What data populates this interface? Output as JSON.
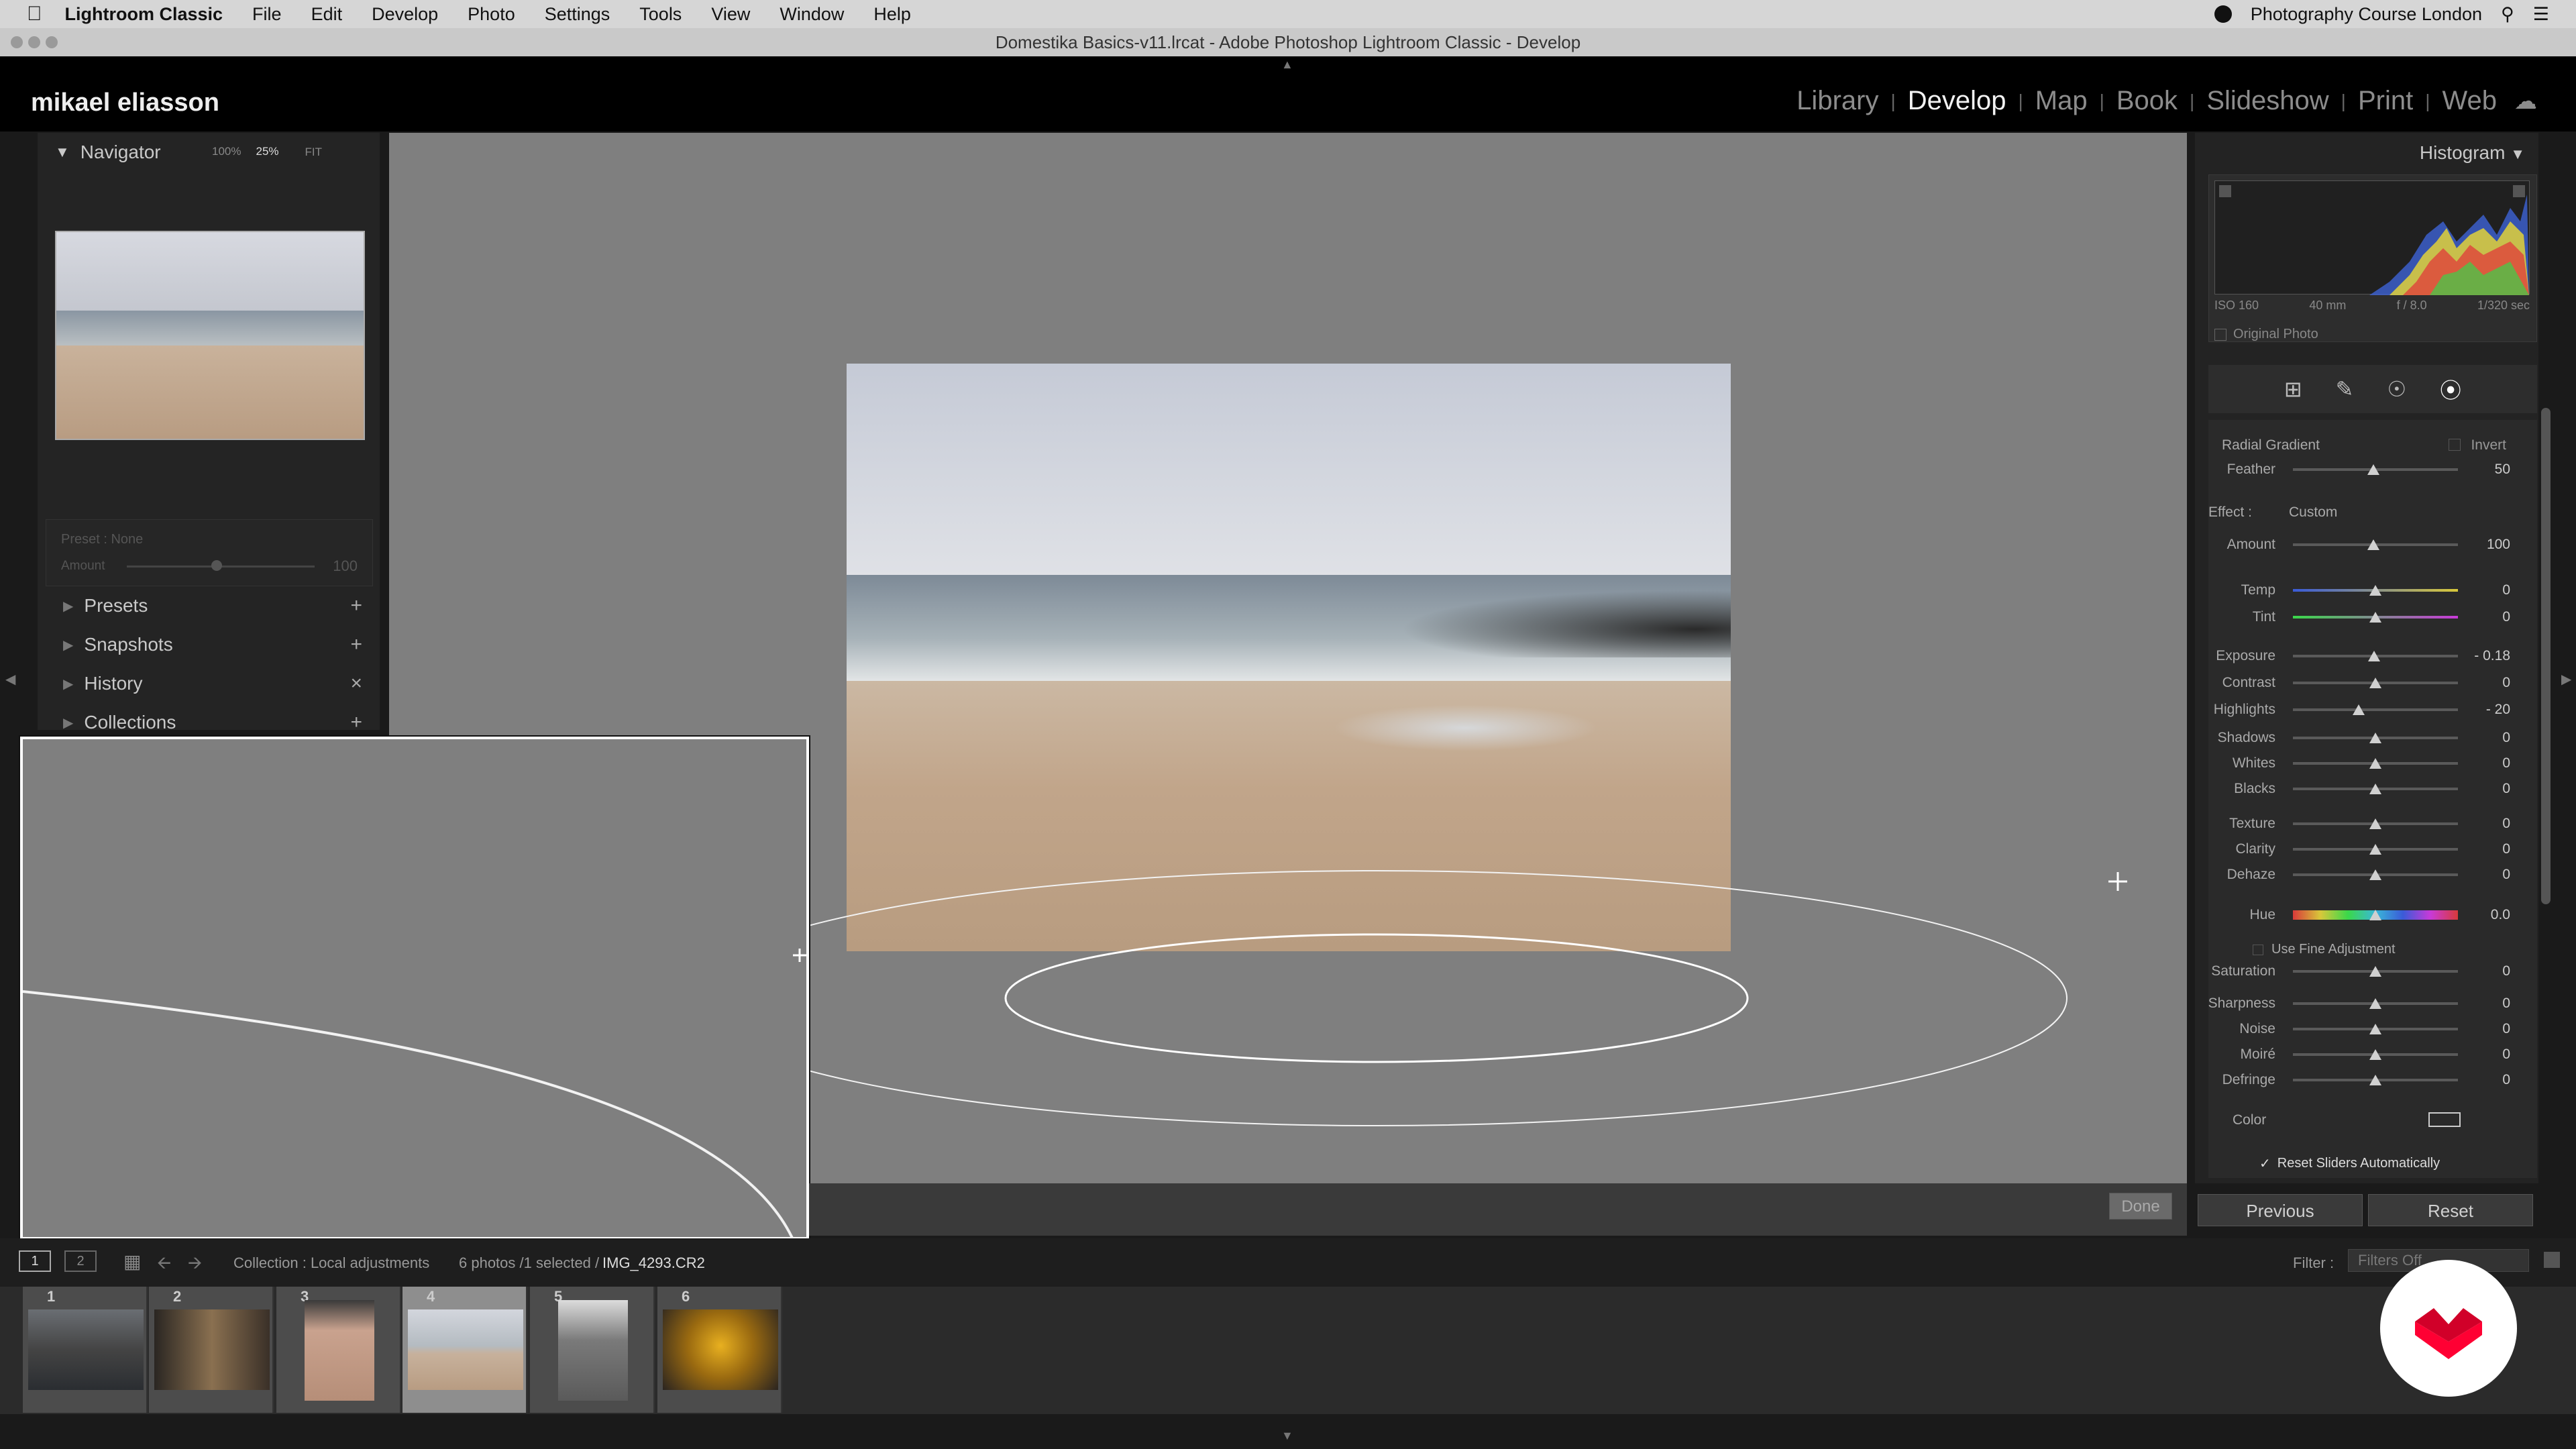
{
  "menubar": {
    "app": "Lightroom Classic",
    "items": [
      "File",
      "Edit",
      "Develop",
      "Photo",
      "Settings",
      "Tools",
      "View",
      "Window",
      "Help"
    ],
    "right_title": "Photography Course London"
  },
  "window_title": "Domestika Basics-v11.lrcat - Adobe Photoshop Lightroom Classic - Develop",
  "identity": "mikael eliasson",
  "modules": [
    "Library",
    "Develop",
    "Map",
    "Book",
    "Slideshow",
    "Print",
    "Web"
  ],
  "navigator": {
    "title": "Navigator",
    "zoom": [
      "FIT",
      "100%",
      "25%"
    ]
  },
  "preset": {
    "label": "Preset : None",
    "amount_label": "Amount",
    "amount_value": "100"
  },
  "left_sections": [
    "Presets",
    "Snapshots",
    "History",
    "Collections"
  ],
  "histogram": {
    "title": "Histogram",
    "iso": "ISO 160",
    "focal": "40 mm",
    "aperture": "f / 8.0",
    "shutter": "1/320 sec",
    "original_photo": "Original Photo"
  },
  "radial": {
    "title": "Radial Gradient",
    "invert": "Invert",
    "feather_label": "Feather",
    "feather_value": "50",
    "effect_label": "Effect :",
    "effect_value": "Custom",
    "amount_label": "Amount",
    "amount_value": "100"
  },
  "sliders": [
    {
      "label": "Temp",
      "value": "0",
      "pos": 0.5
    },
    {
      "label": "Tint",
      "value": "0",
      "pos": 0.5
    },
    {
      "label": "Exposure",
      "value": "- 0.18",
      "pos": 0.49
    },
    {
      "label": "Contrast",
      "value": "0",
      "pos": 0.5
    },
    {
      "label": "Highlights",
      "value": "- 20",
      "pos": 0.4
    },
    {
      "label": "Shadows",
      "value": "0",
      "pos": 0.5
    },
    {
      "label": "Whites",
      "value": "0",
      "pos": 0.5
    },
    {
      "label": "Blacks",
      "value": "0",
      "pos": 0.5
    },
    {
      "label": "Texture",
      "value": "0",
      "pos": 0.5
    },
    {
      "label": "Clarity",
      "value": "0",
      "pos": 0.5
    },
    {
      "label": "Dehaze",
      "value": "0",
      "pos": 0.5
    },
    {
      "label": "Hue",
      "value": "0.0",
      "pos": 0.5
    },
    {
      "label": "Saturation",
      "value": "0",
      "pos": 0.5
    },
    {
      "label": "Sharpness",
      "value": "0",
      "pos": 0.5
    },
    {
      "label": "Noise",
      "value": "0",
      "pos": 0.5
    },
    {
      "label": "Moiré",
      "value": "0",
      "pos": 0.5
    },
    {
      "label": "Defringe",
      "value": "0",
      "pos": 0.5
    }
  ],
  "fine_adjust": "Use Fine Adjustment",
  "color_label": "Color",
  "reset_sliders": "Reset Sliders Automatically",
  "buttons": {
    "previous": "Previous",
    "reset": "Reset",
    "done": "Done"
  },
  "bottom": {
    "collection": "Collection : Local adjustments",
    "count": "6 photos /1 selected /",
    "filename": "IMG_4293.CR2",
    "filter_label": "Filter :",
    "filter_value": "Filters Off"
  },
  "filmstrip": [
    {
      "num": "1"
    },
    {
      "num": "2"
    },
    {
      "num": "3"
    },
    {
      "num": "4"
    },
    {
      "num": "5"
    },
    {
      "num": "6"
    }
  ],
  "colors": {
    "accent": "#ff0033",
    "panel": "#232323",
    "canvas": "#7f7f7f"
  }
}
